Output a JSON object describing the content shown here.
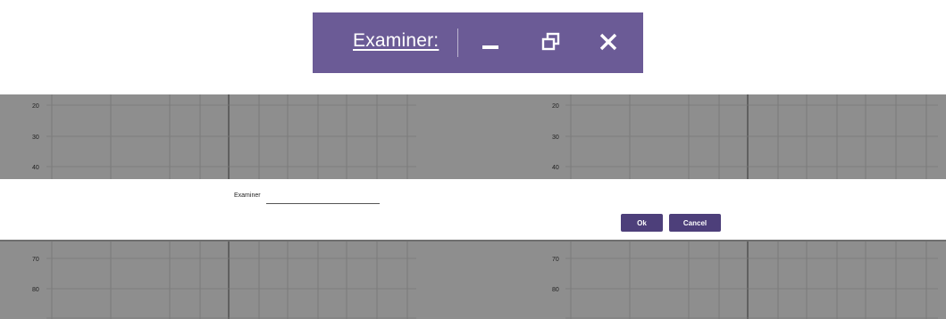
{
  "titlebar": {
    "title": "Examiner:",
    "minimize_icon": "minimize-icon",
    "restore_icon": "restore-icon",
    "close_icon": "close-icon",
    "color": "#6b5b96"
  },
  "charts": {
    "top_left_ticks": [
      "20",
      "30",
      "40"
    ],
    "top_right_ticks": [
      "20",
      "30",
      "40"
    ],
    "bottom_left_ticks": [
      "70",
      "80"
    ],
    "bottom_right_ticks": [
      "70",
      "80"
    ]
  },
  "dialog": {
    "examiner_label": "Examiner",
    "examiner_value": "",
    "ok_label": "Ok",
    "cancel_label": "Cancel",
    "button_color": "#4d3f7a"
  }
}
